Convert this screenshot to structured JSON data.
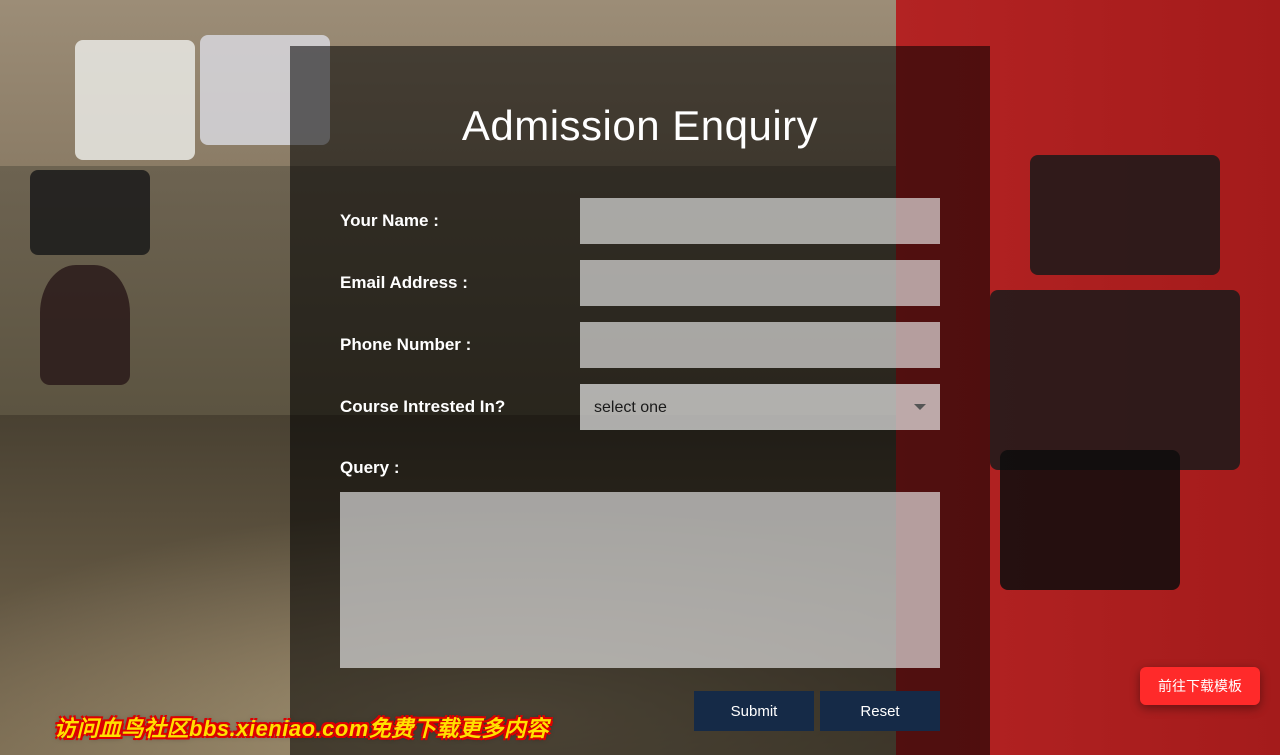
{
  "form": {
    "title": "Admission Enquiry",
    "name_label": "Your Name :",
    "email_label": "Email Address :",
    "phone_label": "Phone Number :",
    "course_label": "Course Intrested In?",
    "course_placeholder": "select one",
    "query_label": "Query :",
    "submit_label": "Submit",
    "reset_label": "Reset",
    "name_value": "",
    "email_value": "",
    "phone_value": "",
    "query_value": ""
  },
  "overlay": {
    "download_label": "前往下载模板",
    "watermark_text": "访问血鸟社区bbs.xieniao.com免费下载更多内容"
  }
}
